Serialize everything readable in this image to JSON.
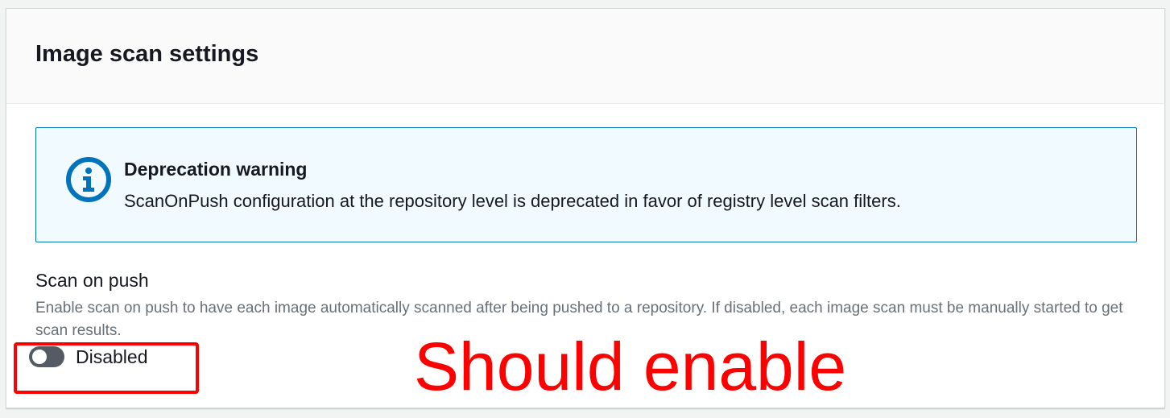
{
  "panel": {
    "title": "Image scan settings"
  },
  "alert": {
    "icon": "info-icon",
    "heading": "Deprecation warning",
    "text": "ScanOnPush configuration at the repository level is deprecated in favor of registry level scan filters.",
    "border_color": "#0073bb",
    "background_color": "#f1faff"
  },
  "scan_on_push": {
    "label": "Scan on push",
    "description": "Enable scan on push to have each image automatically scanned after being pushed to a repository. If disabled, each image scan must be manually started to get scan results.",
    "toggle_state": "off",
    "toggle_label": "Disabled"
  },
  "annotation": {
    "text": "Should enable",
    "color": "#ff0000"
  }
}
